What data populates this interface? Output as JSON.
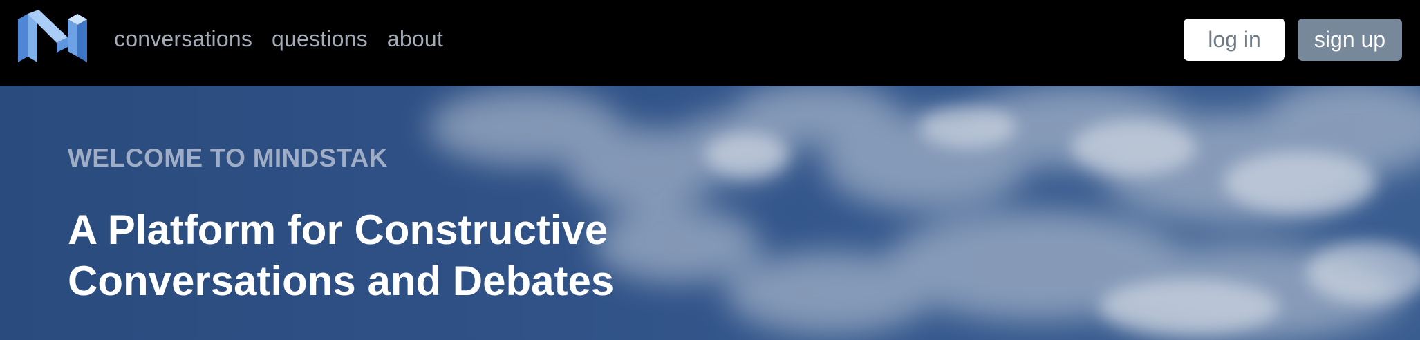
{
  "brand": {
    "logo_icon": "mindstak-m-logo-icon"
  },
  "nav": {
    "links": [
      {
        "label": "conversations"
      },
      {
        "label": "questions"
      },
      {
        "label": "about"
      }
    ]
  },
  "auth": {
    "login_label": "log in",
    "signup_label": "sign up"
  },
  "hero": {
    "kicker": "WELCOME TO MINDSTAK",
    "title_line1": "A Platform for Constructive",
    "title_line2": "Conversations and Debates",
    "background": "sky-with-clouds"
  },
  "colors": {
    "navbar_bg": "#000000",
    "nav_link": "#a3abb7",
    "login_bg": "#ffffff",
    "login_text": "#6f7a87",
    "signup_bg": "#77889b",
    "signup_text": "#ffffff",
    "hero_overlay": "#2f5186",
    "kicker": "#9fadc6",
    "title": "#ffffff"
  }
}
